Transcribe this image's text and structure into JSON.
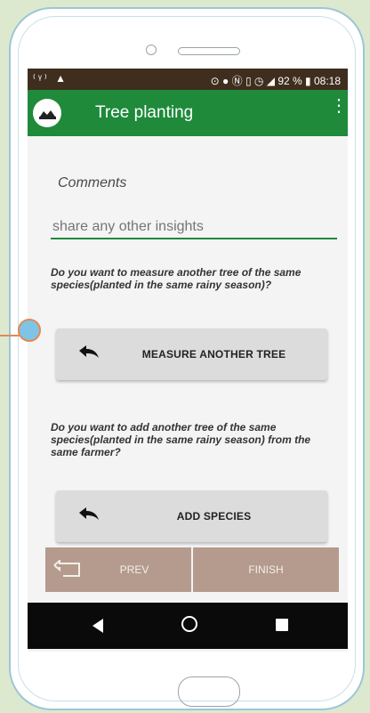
{
  "status_bar": {
    "left_icons": [
      "wifi-signal-icon",
      "warning-icon"
    ],
    "right_icons": [
      "sync-icon",
      "location-icon",
      "nfc-icon",
      "vibrate-icon",
      "alarm-icon",
      "cell-signal-icon"
    ],
    "battery": "92 %",
    "time": "08:18"
  },
  "app_bar": {
    "title": "Tree planting",
    "logo_icon": "farmer-logo-icon",
    "menu_icon": "more-vert-icon",
    "color": "#1e8a3a"
  },
  "form": {
    "comments_label": "Comments",
    "comments_placeholder": "share any other insights",
    "question_measure": "Do you want to measure another tree of the same species(planted in the same rainy season)?",
    "measure_button": "MEASURE ANOTHER TREE",
    "question_add": "Do you want to add another tree of the same species(planted in the same rainy season) from the same farmer?",
    "add_button": "ADD SPECIES"
  },
  "bottom_nav": {
    "prev_label": "PREV",
    "finish_label": "FINISH",
    "color": "#b49b8e"
  },
  "system_nav": {
    "icons": [
      "back-icon",
      "home-icon",
      "recents-icon"
    ]
  }
}
